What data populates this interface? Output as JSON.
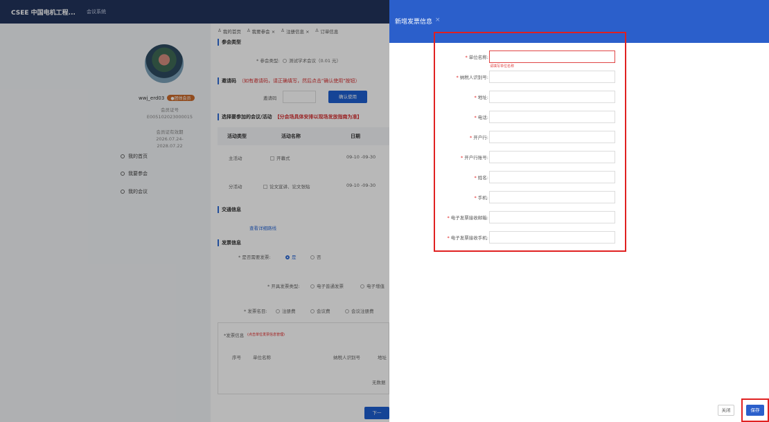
{
  "topbar": {
    "brand": "CSEE 中国电机工程...",
    "sub": "会议系统"
  },
  "sidebar": {
    "username": "wwj_erd03",
    "member_badge": "●团体会员",
    "cert_label": "会员证号",
    "cert_no": "E005102023000015",
    "valid_label": "会员证有效期",
    "valid_range": "2026.07.24-2028.07.22",
    "menu": [
      "我的首页",
      "我要参会",
      "我的会议"
    ]
  },
  "tabs": [
    "我的首页",
    "我要参会 ×",
    "注册信息 ×",
    "订单信息"
  ],
  "main": {
    "sec_type": "参会类型",
    "type_label": "* 参会类型:",
    "type_value": "测试学术会议（0.01 元）",
    "sec_invite": "邀请码",
    "invite_note": "（如有邀请码，请正确填写，然后点击\"确认使用\"按钮）",
    "invite_label": "邀请码",
    "invite_btn": "确认使用",
    "sec_select": "选择要参加的会议/活动",
    "select_note": "【分会场具体安排以现场发放指南为准】",
    "th": [
      "活动类型",
      "活动名称",
      "日期"
    ],
    "rows": [
      {
        "type": "主活动",
        "name": "开幕式",
        "date": "09-10 -09-30"
      },
      {
        "type": "分活动",
        "name": "论文宣讲、论文张贴",
        "date": "09-10 -09-30"
      }
    ],
    "sec_traffic": "交通信息",
    "traffic_link": "查看详细路线",
    "sec_invoice": "发票信息",
    "need_label": "* 是否需要发票:",
    "need_yes": "是",
    "need_no": "否",
    "kind_label": "* 开具发票类型:",
    "kind_opt1": "电子普通发票",
    "kind_opt2": "电子增值",
    "item_label": "* 发票名目:",
    "item_opts": [
      "注册费",
      "会议费",
      "会议注册费"
    ],
    "inv_info_label": "*发票信息",
    "inv_info_note": "(点击单位发票信息管理)",
    "inv_th": [
      "序号",
      "单位名称",
      "纳税人识别号",
      "地址"
    ],
    "empty": "无数据",
    "next_btn": "下一"
  },
  "dialog": {
    "title": "新增发票信息",
    "close_x": "×",
    "error_tip": "请填写单位名称",
    "fields": [
      "单位名称:",
      "纳税人识别号:",
      "地址:",
      "电话:",
      "开户行:",
      "开户行账号:",
      "姓名:",
      "手机:",
      "电子发票接收邮箱:",
      "电子发票接收手机:"
    ],
    "close_btn": "关闭",
    "save_btn": "保存"
  },
  "colors": {
    "primary": "#2b5fcb",
    "error": "#e02020",
    "topbar": "#22345c"
  }
}
